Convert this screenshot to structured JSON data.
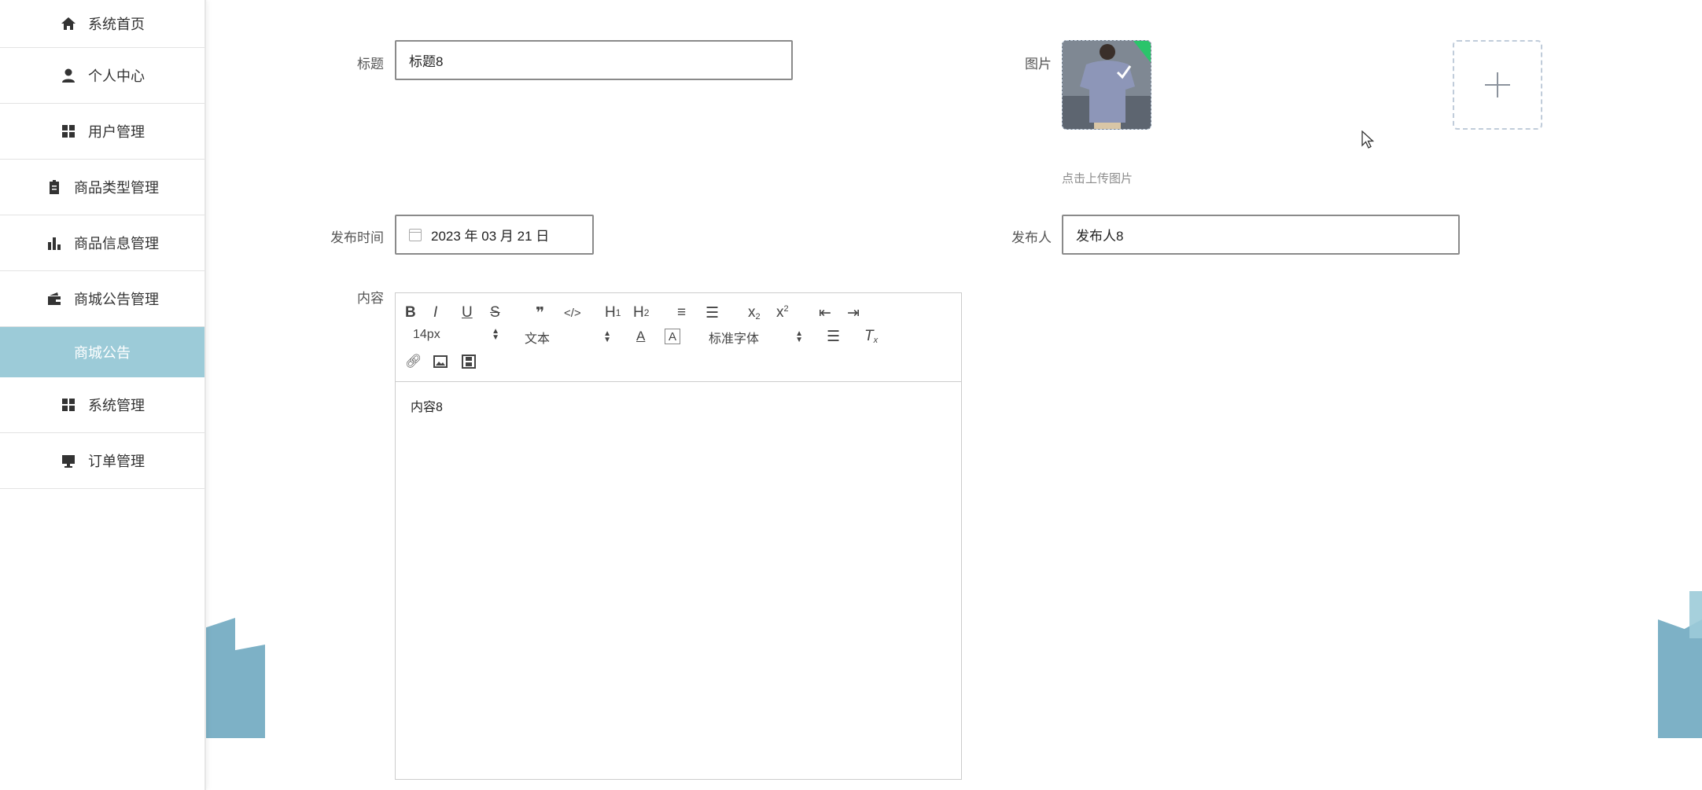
{
  "sidebar": {
    "items": [
      {
        "label": "系统首页",
        "icon": "home-icon"
      },
      {
        "label": "个人中心",
        "icon": "user-icon"
      },
      {
        "label": "用户管理",
        "icon": "grid-icon"
      },
      {
        "label": "商品类型管理",
        "icon": "clipboard-icon"
      },
      {
        "label": "商品信息管理",
        "icon": "bar-chart-icon"
      },
      {
        "label": "商城公告管理",
        "icon": "wallet-icon"
      }
    ],
    "active_sub": "商城公告",
    "items_after": [
      {
        "label": "系统管理",
        "icon": "grid-icon"
      },
      {
        "label": "订单管理",
        "icon": "monitor-icon"
      }
    ]
  },
  "form": {
    "title_label": "标题",
    "title_value": "标题8",
    "image_label": "图片",
    "upload_tip": "点击上传图片",
    "publish_time_label": "发布时间",
    "publish_time_value": "2023 年 03 月 21 日",
    "publisher_label": "发布人",
    "publisher_value": "发布人8",
    "content_label": "内容"
  },
  "editor": {
    "font_size": "14px",
    "block_format": "文本",
    "font_family": "标准字体",
    "content": "内容8"
  },
  "colors": {
    "active_sub_bg": "#9ccbd8",
    "deco_blue": "#6fa8c0"
  }
}
